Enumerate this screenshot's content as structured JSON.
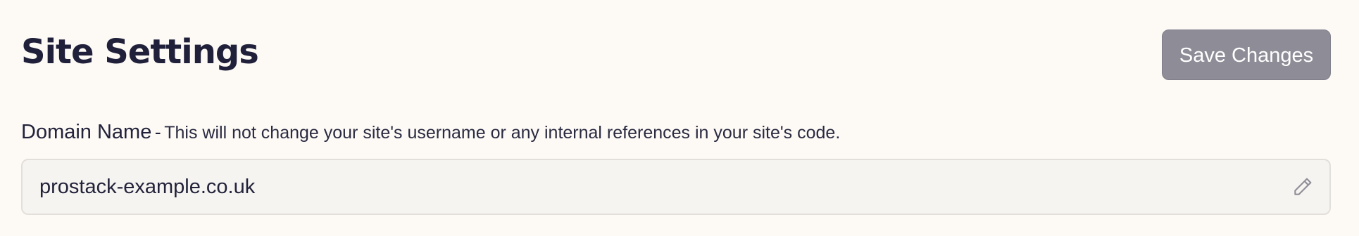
{
  "header": {
    "title": "Site Settings",
    "save_label": "Save Changes"
  },
  "domain": {
    "label": "Domain Name",
    "separator": "-",
    "hint": "This will not change your site's username or any internal references in your site's code.",
    "value": "prostack-example.co.uk",
    "edit_icon": "pencil-icon"
  },
  "colors": {
    "background": "#fdfaf6",
    "title": "#20203a",
    "save_button_bg": "#8e8d97",
    "field_bg": "#f6f4f1",
    "field_border": "#e2dfdb"
  }
}
